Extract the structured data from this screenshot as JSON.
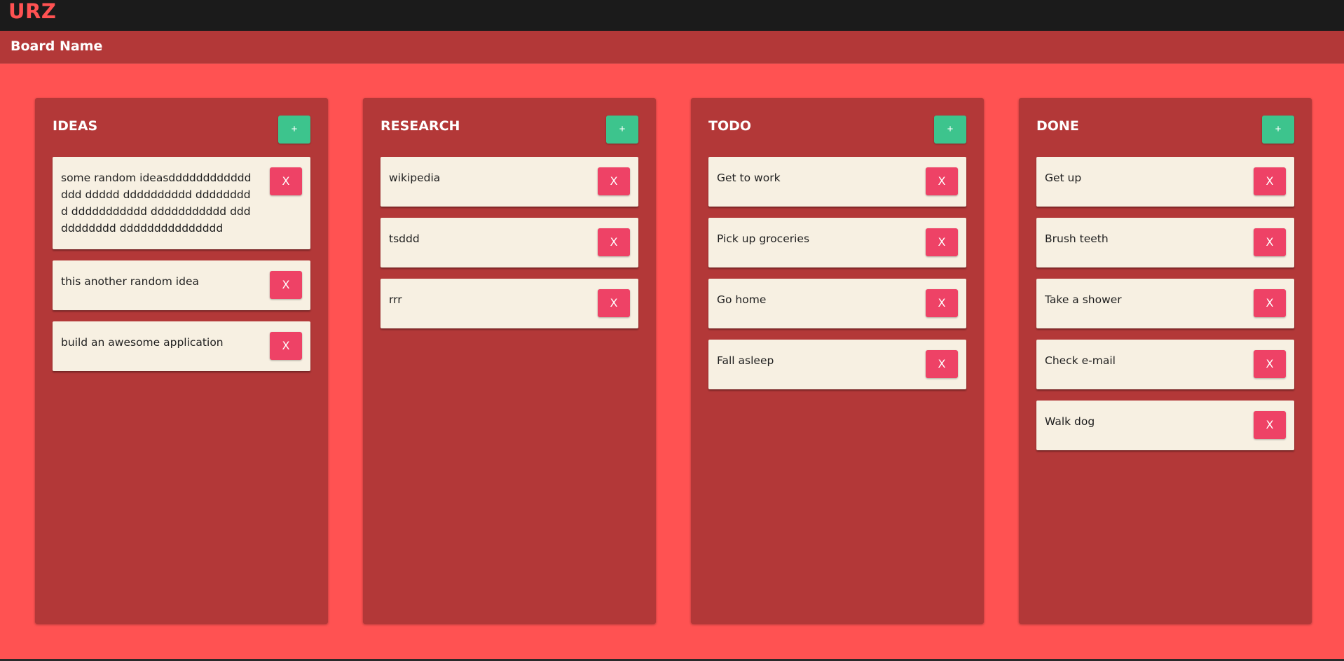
{
  "app": {
    "logo": "URZ",
    "board_name": "Board Name"
  },
  "colors": {
    "background": "#ff5252",
    "column": "#b33838",
    "card": "#f7f0e2",
    "add_button": "#3dc48d",
    "delete_button": "#ee4266",
    "topbar": "#1b1b1b"
  },
  "columns": [
    {
      "title": "IDEAS",
      "add_label": "+",
      "cards": [
        {
          "text": "some random ideasddddddddddddddd ddddd dddddddddd ddddddddd ddddddddddd ddddddddddd ddddddddddd ddddddddddddddd",
          "delete_label": "X"
        },
        {
          "text": "this another random idea",
          "delete_label": "X"
        },
        {
          "text": "build an awesome application",
          "delete_label": "X"
        }
      ]
    },
    {
      "title": "RESEARCH",
      "add_label": "+",
      "cards": [
        {
          "text": "wikipedia",
          "delete_label": "X"
        },
        {
          "text": "tsddd",
          "delete_label": "X"
        },
        {
          "text": "rrr",
          "delete_label": "X"
        }
      ]
    },
    {
      "title": "TODO",
      "add_label": "+",
      "cards": [
        {
          "text": "Get to work",
          "delete_label": "X"
        },
        {
          "text": "Pick up groceries",
          "delete_label": "X"
        },
        {
          "text": "Go home",
          "delete_label": "X"
        },
        {
          "text": "Fall asleep",
          "delete_label": "X"
        }
      ]
    },
    {
      "title": "DONE",
      "add_label": "+",
      "cards": [
        {
          "text": "Get up",
          "delete_label": "X"
        },
        {
          "text": "Brush teeth",
          "delete_label": "X"
        },
        {
          "text": "Take a shower",
          "delete_label": "X"
        },
        {
          "text": "Check e-mail",
          "delete_label": "X"
        },
        {
          "text": "Walk dog",
          "delete_label": "X"
        }
      ]
    }
  ]
}
